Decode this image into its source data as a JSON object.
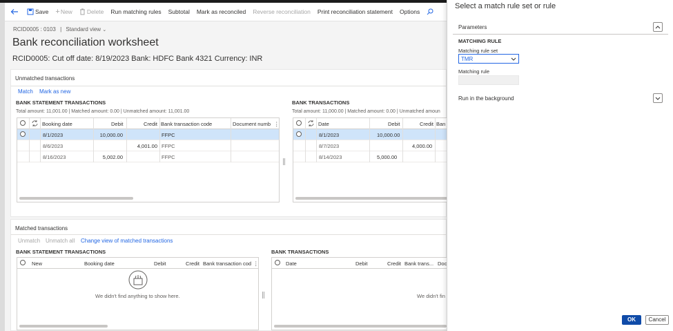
{
  "toolbar": {
    "save": "Save",
    "new": "New",
    "delete": "Delete",
    "run_matching_rules": "Run matching rules",
    "subtotal": "Subtotal",
    "mark_as_reconciled": "Mark as reconciled",
    "reverse_reconciliation": "Reverse reconciliation",
    "print_statement": "Print reconciliation statement",
    "options": "Options"
  },
  "breadcrumb": {
    "record": "RCID0005 : 0103",
    "separator": "|",
    "view": "Standard view"
  },
  "page": {
    "title": "Bank reconciliation worksheet",
    "subtitle": "RCID0005: Cut off date: 8/19/2023 Bank: HDFC Bank 4321 Currency: INR"
  },
  "unmatched": {
    "header": "Unmatched transactions",
    "match": "Match",
    "mark_as_new": "Mark as new",
    "bank_statement": {
      "label": "BANK STATEMENT TRANSACTIONS",
      "totals": "Total amount: 11,001.00 | Matched amount: 0.00 | Unmatched amount: 11,001.00",
      "columns": [
        "Booking date",
        "Debit",
        "Credit",
        "Bank transaction code",
        "Document numb"
      ],
      "rows": [
        {
          "date": "8/1/2023",
          "debit": "10,000.00",
          "credit": "",
          "code": "FFPC",
          "doc": ""
        },
        {
          "date": "8/6/2023",
          "debit": "",
          "credit": "4,001.00",
          "code": "FFPC",
          "doc": ""
        },
        {
          "date": "8/16/2023",
          "debit": "5,002.00",
          "credit": "",
          "code": "FFPC",
          "doc": ""
        }
      ]
    },
    "bank": {
      "label": "BANK TRANSACTIONS",
      "totals": "Total amount: 11,000.00 | Matched amount: 0.00 | Unmatched amoun",
      "columns": [
        "Date",
        "Debit",
        "Credit",
        "Ban"
      ],
      "rows": [
        {
          "date": "8/1/2023",
          "debit": "10,000.00",
          "credit": ""
        },
        {
          "date": "8/7/2023",
          "debit": "",
          "credit": "4,000.00"
        },
        {
          "date": "8/14/2023",
          "debit": "5,000.00",
          "credit": ""
        }
      ]
    }
  },
  "matched": {
    "header": "Matched transactions",
    "unmatch": "Unmatch",
    "unmatch_all": "Unmatch all",
    "change_view": "Change view of matched transactions",
    "bank_statement": {
      "label": "BANK STATEMENT TRANSACTIONS",
      "columns": [
        "New",
        "Booking date",
        "Debit",
        "Credit",
        "Bank transaction cod"
      ],
      "empty": "We didn't find anything to show here."
    },
    "bank": {
      "label": "BANK TRANSACTIONS",
      "columns": [
        "Date",
        "Debit",
        "Credit",
        "Bank trans...",
        "Doc"
      ],
      "empty": "We didn't fin"
    }
  },
  "dialog": {
    "title": "Select a match rule set or rule",
    "parameters": "Parameters",
    "section": "MATCHING RULE",
    "rule_set_label": "Matching rule set",
    "rule_set_value": "TMR",
    "rule_label": "Matching rule",
    "run_background": "Run in the background",
    "ok": "OK",
    "cancel": "Cancel"
  },
  "colors": {
    "accent": "#2266e3",
    "selected_row": "#cfe4fa",
    "ok_button": "#0f4ba8"
  }
}
